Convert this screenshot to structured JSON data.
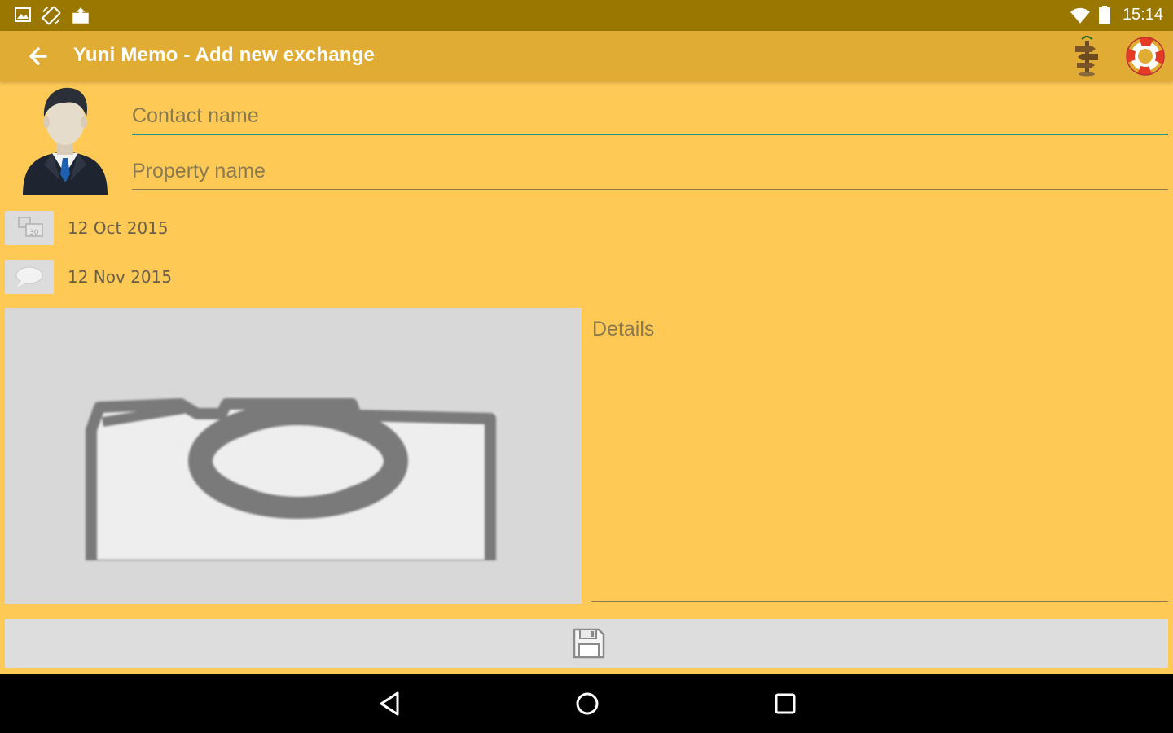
{
  "status_bar": {
    "time": "15:14",
    "left_icons": [
      "gallery-icon",
      "rotation-icon",
      "upload-icon"
    ],
    "right_icons": [
      "wifi-icon",
      "battery-icon"
    ]
  },
  "app_bar": {
    "title": "Yuni Memo - Add new exchange",
    "actions": [
      "signpost-icon",
      "lifebuoy-icon"
    ]
  },
  "form": {
    "contact_name_placeholder": "Contact name",
    "property_name_placeholder": "Property name",
    "start_date": "12 Oct 2015",
    "end_date": "12 Nov 2015",
    "details_placeholder": "Details"
  },
  "colors": {
    "status_bar": "#9A7700",
    "app_bar": "#E0AC33",
    "background": "#FFC955",
    "focus_underline": "#1E9184"
  }
}
